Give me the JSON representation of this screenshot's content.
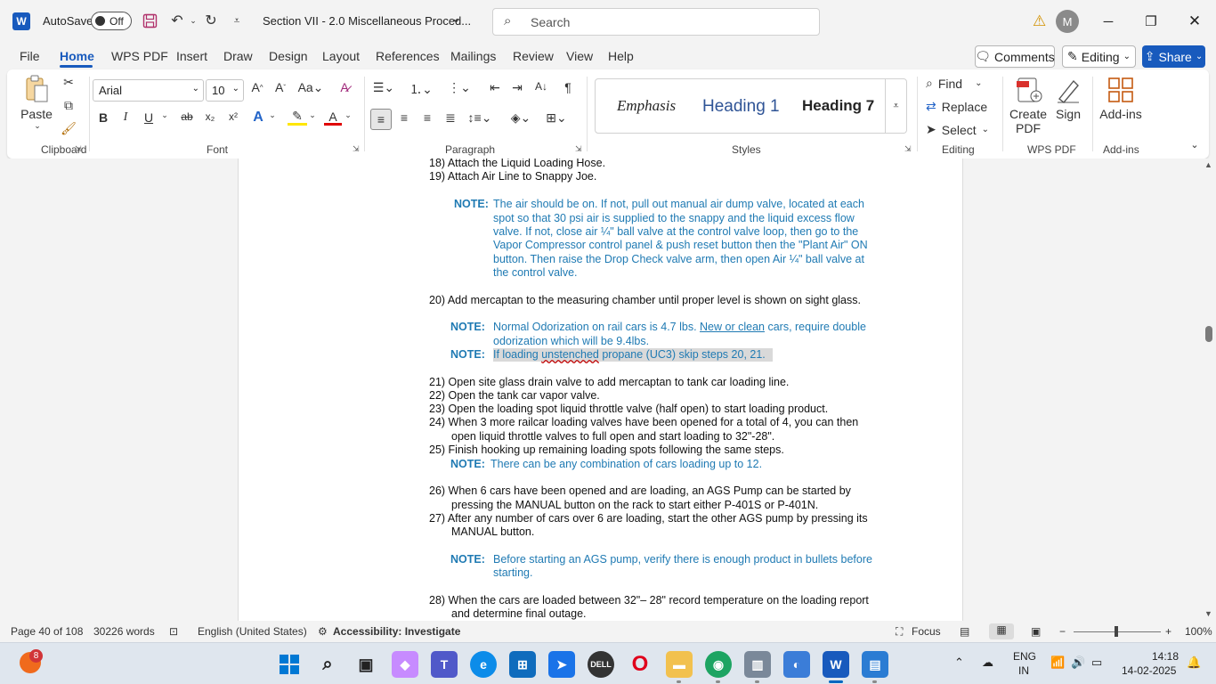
{
  "titlebar": {
    "autosave_label": "AutoSave",
    "autosave_state": "Off",
    "doc_title": "Section VII - 2.0 Miscellaneous Proced...",
    "search_placeholder": "Search",
    "user_initial": "M"
  },
  "tabs": [
    "File",
    "Home",
    "WPS PDF",
    "Insert",
    "Draw",
    "Design",
    "Layout",
    "References",
    "Mailings",
    "Review",
    "View",
    "Help"
  ],
  "tab_active": "Home",
  "right_buttons": {
    "comments": "Comments",
    "editing": "Editing",
    "share": "Share"
  },
  "ribbon": {
    "clipboard": {
      "paste": "Paste",
      "label": "Clipboard"
    },
    "font": {
      "name": "Arial",
      "size": "10",
      "label": "Font"
    },
    "paragraph": {
      "label": "Paragraph"
    },
    "styles": {
      "items": [
        "Emphasis",
        "Heading 1",
        "Heading 7"
      ],
      "label": "Styles"
    },
    "editing": {
      "find": "Find",
      "replace": "Replace",
      "select": "Select",
      "label": "Editing"
    },
    "wps": {
      "create_pdf_1": "Create",
      "create_pdf_2": "PDF",
      "sign": "Sign",
      "label": "WPS PDF"
    },
    "addins": {
      "button": "Add-ins",
      "label": "Add-ins"
    }
  },
  "document": {
    "l1": "18)  Attach the Liquid Loading Hose.",
    "l2": "19)  Attach Air Line to Snappy Joe.",
    "n1_label": "NOTE:",
    "n1_l1": "The air should be on. If not, pull out manual air dump valve, located at each",
    "n1_l2": "spot so that 30 psi air is supplied to the snappy and the liquid excess flow",
    "n1_l3": "valve. If not, close air ¼\" ball valve at the control valve loop, then go to the",
    "n1_l4": "Vapor Compressor control panel & push reset button then the \"Plant Air\" ON",
    "n1_l5": "button. Then raise the Drop Check valve arm, then open Air ¼\" ball valve at",
    "n1_l6": "the control valve.",
    "l20": "20)  Add mercaptan to the measuring chamber until proper level is shown on sight glass.",
    "n2_label": "NOTE:",
    "n2_l1a": "Normal Odorization on rail cars is 4.7 lbs. ",
    "n2_l1b": "New or clean",
    "n2_l1c": " cars, require double",
    "n2_l2": "odorization which will be 9.4lbs.",
    "n3_label": "NOTE:",
    "n3_a": "If loading ",
    "n3_b": "unstenched",
    "n3_c": " propane (UC3) skip steps 20, 21.",
    "l21": "21)  Open site glass drain valve to add mercaptan to tank car loading line.",
    "l22": "22)  Open the tank car vapor valve.",
    "l23": "23)  Open the loading spot liquid throttle valve (half open) to start loading product.",
    "l24a": "24)  When 3 more railcar loading valves have been opened for a total of 4, you can then",
    "l24b": "open liquid throttle valves to full open and start loading to 32\"-28\".",
    "l25": "25)  Finish hooking up remaining loading spots following the same steps.",
    "n4_label": "NOTE:",
    "n4": "There can be any combination of cars loading up to 12.",
    "l26a": "26)  When 6 cars have been opened and are loading, an AGS Pump can be started by",
    "l26b": "pressing the MANUAL button on the rack to start either P-401S or P-401N.",
    "l27a": "27)  After any number of cars over 6 are loading, start the other AGS pump by pressing its",
    "l27b": "MANUAL button.",
    "n5_label": "NOTE:",
    "n5_l1": "Before starting an AGS pump, verify there is enough product in bullets before",
    "n5_l2": "starting.",
    "l28a": "28)  When the cars are loaded between 32\"– 28\" record temperature on the loading report",
    "l28b": "and determine final outage."
  },
  "statusbar": {
    "page": "Page 40 of 108",
    "words": "30226 words",
    "language": "English (United States)",
    "accessibility": "Accessibility: Investigate",
    "focus": "Focus",
    "zoom": "100%"
  },
  "taskbar": {
    "badge": "8",
    "lang_1": "ENG",
    "lang_2": "IN",
    "time": "14:18",
    "date": "14-02-2025"
  },
  "colors": {
    "accent": "#185abd",
    "note_blue": "#1f7ab3",
    "highlight": "#d9d9d9"
  }
}
